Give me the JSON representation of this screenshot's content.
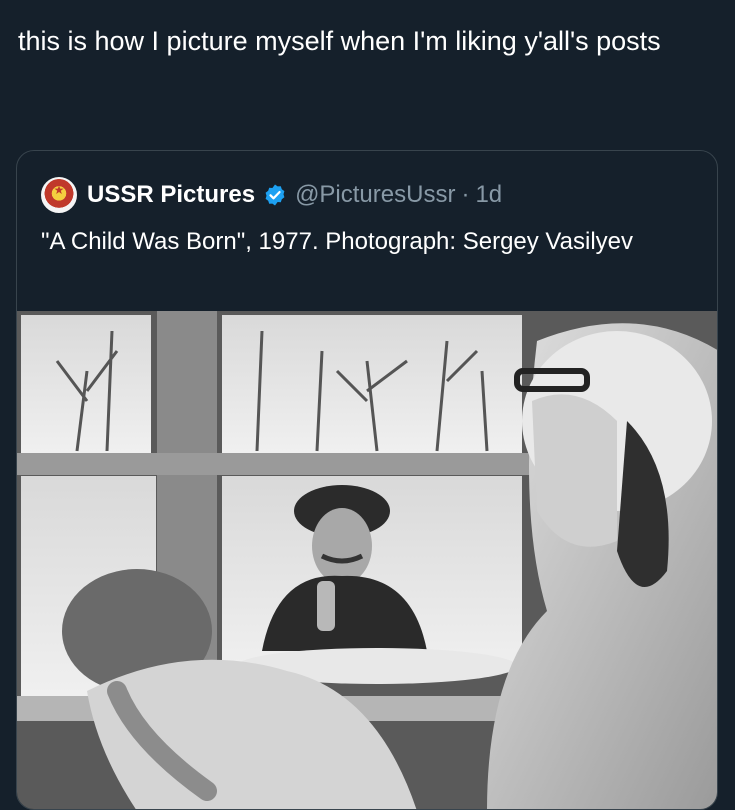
{
  "tweet": {
    "text": "this is how I picture myself when I'm liking y'all's posts"
  },
  "quoted_tweet": {
    "display_name": "USSR Pictures",
    "handle": "@PicturesUssr",
    "separator": "·",
    "time": "1d",
    "text": "\"A Child Was Born\", 1977. Photograph: Sergey Vasilyev",
    "verified_color": "#1da1f2",
    "avatar_icon": "ussr-emblem-icon"
  },
  "photo": {
    "icon": "black-and-white-photo"
  },
  "colors": {
    "background": "#15202b",
    "border": "#38444d",
    "secondary_text": "#8899a6"
  }
}
